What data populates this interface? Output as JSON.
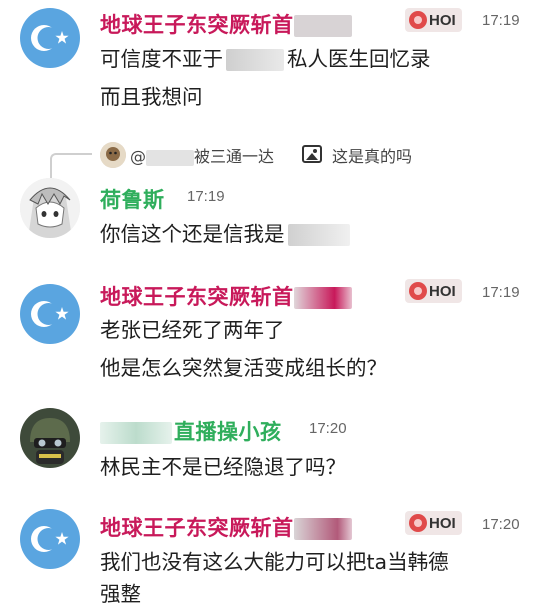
{
  "messages": [
    {
      "author": "地球王子东突厥斩首",
      "badge": "HOI",
      "time": "17:19",
      "lines": [
        "可信度不亚于",
        "私人医生回忆录",
        "而且我想问"
      ]
    },
    {
      "author": "荷鲁斯",
      "time": "17:19",
      "reply": {
        "prefix": "@",
        "target": "被三通一达",
        "quote": "这是真的吗"
      },
      "lines": [
        "你信这个还是信我是"
      ]
    },
    {
      "author": "地球王子东突厥斩首",
      "badge": "HOI",
      "time": "17:19",
      "lines": [
        "老张已经死了两年了",
        "他是怎么突然复活变成组长的？"
      ]
    },
    {
      "author": "直播操小孩",
      "time": "17:20",
      "lines": [
        "林民主不是已经隐退了吗？"
      ]
    },
    {
      "author": "地球王子东突厥斩首",
      "badge": "HOI",
      "time": "17:20",
      "lines": [
        "我们也没有这么大能力可以把ta当韩德",
        "强整"
      ]
    }
  ],
  "icons": {
    "avatar_flag": "crescent-star-icon",
    "badge": "flame-icon",
    "reply_image": "image-icon"
  },
  "colors": {
    "name_red": "#c8195a",
    "name_green": "#2fae5c",
    "flag_blue": "#5aa5e0"
  }
}
